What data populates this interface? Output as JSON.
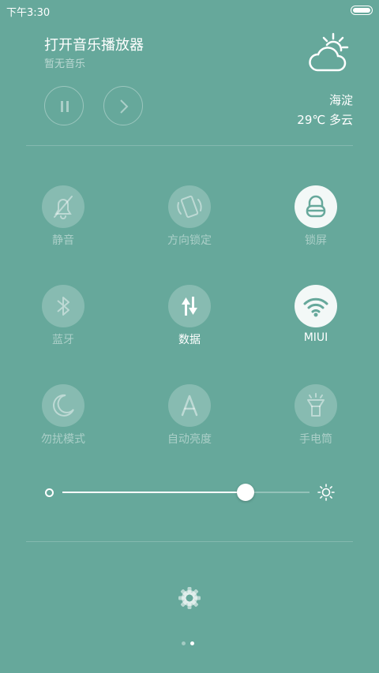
{
  "status_bar": {
    "time": "下午3:30",
    "battery_level": 1.0
  },
  "music": {
    "title": "打开音乐播放器",
    "subtitle": "暂无音乐"
  },
  "weather": {
    "city": "海淀",
    "temperature_condition": "29℃  多云",
    "icon": "partly-cloudy-icon"
  },
  "toggles": [
    {
      "label": "静音",
      "icon": "mute-bell-icon",
      "state": "off"
    },
    {
      "label": "方向锁定",
      "icon": "rotation-lock-icon",
      "state": "off"
    },
    {
      "label": "锁屏",
      "icon": "lock-icon",
      "state": "on"
    },
    {
      "label": "蓝牙",
      "icon": "bluetooth-icon",
      "state": "off"
    },
    {
      "label": "数据",
      "icon": "mobile-data-icon",
      "state": "on"
    },
    {
      "label": "MIUI",
      "icon": "wifi-icon",
      "state": "on"
    },
    {
      "label": "勿扰模式",
      "icon": "moon-icon",
      "state": "off"
    },
    {
      "label": "自动亮度",
      "icon": "auto-brightness-icon",
      "state": "off"
    },
    {
      "label": "手电筒",
      "icon": "flashlight-icon",
      "state": "off"
    }
  ],
  "brightness": {
    "level": 0.74
  },
  "pager": {
    "page_count": 2,
    "current_page": 2
  },
  "colors": {
    "background": "#66a89b",
    "icon_on": "#66a89b",
    "text": "#ffffff"
  }
}
